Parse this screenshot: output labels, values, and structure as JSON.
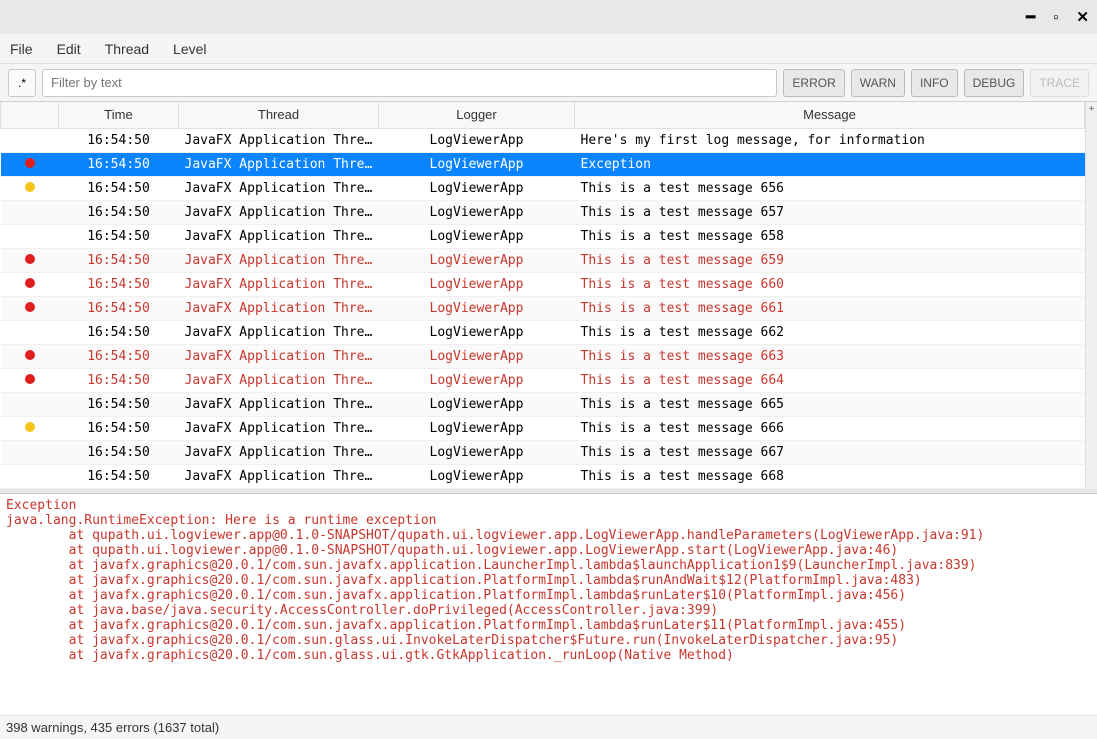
{
  "menu": {
    "file": "File",
    "edit": "Edit",
    "thread": "Thread",
    "level": "Level"
  },
  "toolbar": {
    "regex": ".*",
    "filter_placeholder": "Filter by text",
    "levels": {
      "error": "ERROR",
      "warn": "WARN",
      "info": "INFO",
      "debug": "DEBUG",
      "trace": "TRACE"
    }
  },
  "columns": {
    "time": "Time",
    "thread": "Thread",
    "logger": "Logger",
    "message": "Message"
  },
  "rows": [
    {
      "sev": "",
      "time": "16:54:50",
      "thread": "JavaFX Application Thread",
      "logger": "LogViewerApp",
      "msg": "Here's my first log message, for information",
      "sel": false
    },
    {
      "sev": "error",
      "time": "16:54:50",
      "thread": "JavaFX Application Thread",
      "logger": "LogViewerApp",
      "msg": "Exception",
      "sel": true
    },
    {
      "sev": "warn",
      "time": "16:54:50",
      "thread": "JavaFX Application Thread",
      "logger": "LogViewerApp",
      "msg": "This is a test message 656",
      "sel": false
    },
    {
      "sev": "",
      "time": "16:54:50",
      "thread": "JavaFX Application Thread",
      "logger": "LogViewerApp",
      "msg": "This is a test message 657",
      "sel": false
    },
    {
      "sev": "",
      "time": "16:54:50",
      "thread": "JavaFX Application Thread",
      "logger": "LogViewerApp",
      "msg": "This is a test message 658",
      "sel": false
    },
    {
      "sev": "error",
      "time": "16:54:50",
      "thread": "JavaFX Application Thread",
      "logger": "LogViewerApp",
      "msg": "This is a test message 659",
      "sel": false
    },
    {
      "sev": "error",
      "time": "16:54:50",
      "thread": "JavaFX Application Thread",
      "logger": "LogViewerApp",
      "msg": "This is a test message 660",
      "sel": false
    },
    {
      "sev": "error",
      "time": "16:54:50",
      "thread": "JavaFX Application Thread",
      "logger": "LogViewerApp",
      "msg": "This is a test message 661",
      "sel": false
    },
    {
      "sev": "",
      "time": "16:54:50",
      "thread": "JavaFX Application Thread",
      "logger": "LogViewerApp",
      "msg": "This is a test message 662",
      "sel": false
    },
    {
      "sev": "error",
      "time": "16:54:50",
      "thread": "JavaFX Application Thread",
      "logger": "LogViewerApp",
      "msg": "This is a test message 663",
      "sel": false
    },
    {
      "sev": "error",
      "time": "16:54:50",
      "thread": "JavaFX Application Thread",
      "logger": "LogViewerApp",
      "msg": "This is a test message 664",
      "sel": false
    },
    {
      "sev": "",
      "time": "16:54:50",
      "thread": "JavaFX Application Thread",
      "logger": "LogViewerApp",
      "msg": "This is a test message 665",
      "sel": false
    },
    {
      "sev": "warn",
      "time": "16:54:50",
      "thread": "JavaFX Application Thread",
      "logger": "LogViewerApp",
      "msg": "This is a test message 666",
      "sel": false
    },
    {
      "sev": "",
      "time": "16:54:50",
      "thread": "JavaFX Application Thread",
      "logger": "LogViewerApp",
      "msg": "This is a test message 667",
      "sel": false
    },
    {
      "sev": "",
      "time": "16:54:50",
      "thread": "JavaFX Application Thread",
      "logger": "LogViewerApp",
      "msg": "This is a test message 668",
      "sel": false
    }
  ],
  "detail_lines": [
    "Exception",
    "java.lang.RuntimeException: Here is a runtime exception",
    "        at qupath.ui.logviewer.app@0.1.0-SNAPSHOT/qupath.ui.logviewer.app.LogViewerApp.handleParameters(LogViewerApp.java:91)",
    "        at qupath.ui.logviewer.app@0.1.0-SNAPSHOT/qupath.ui.logviewer.app.LogViewerApp.start(LogViewerApp.java:46)",
    "        at javafx.graphics@20.0.1/com.sun.javafx.application.LauncherImpl.lambda$launchApplication1$9(LauncherImpl.java:839)",
    "        at javafx.graphics@20.0.1/com.sun.javafx.application.PlatformImpl.lambda$runAndWait$12(PlatformImpl.java:483)",
    "        at javafx.graphics@20.0.1/com.sun.javafx.application.PlatformImpl.lambda$runLater$10(PlatformImpl.java:456)",
    "        at java.base/java.security.AccessController.doPrivileged(AccessController.java:399)",
    "        at javafx.graphics@20.0.1/com.sun.javafx.application.PlatformImpl.lambda$runLater$11(PlatformImpl.java:455)",
    "        at javafx.graphics@20.0.1/com.sun.glass.ui.InvokeLaterDispatcher$Future.run(InvokeLaterDispatcher.java:95)",
    "        at javafx.graphics@20.0.1/com.sun.glass.ui.gtk.GtkApplication._runLoop(Native Method)"
  ],
  "status": "398 warnings, 435 errors (1637 total)"
}
